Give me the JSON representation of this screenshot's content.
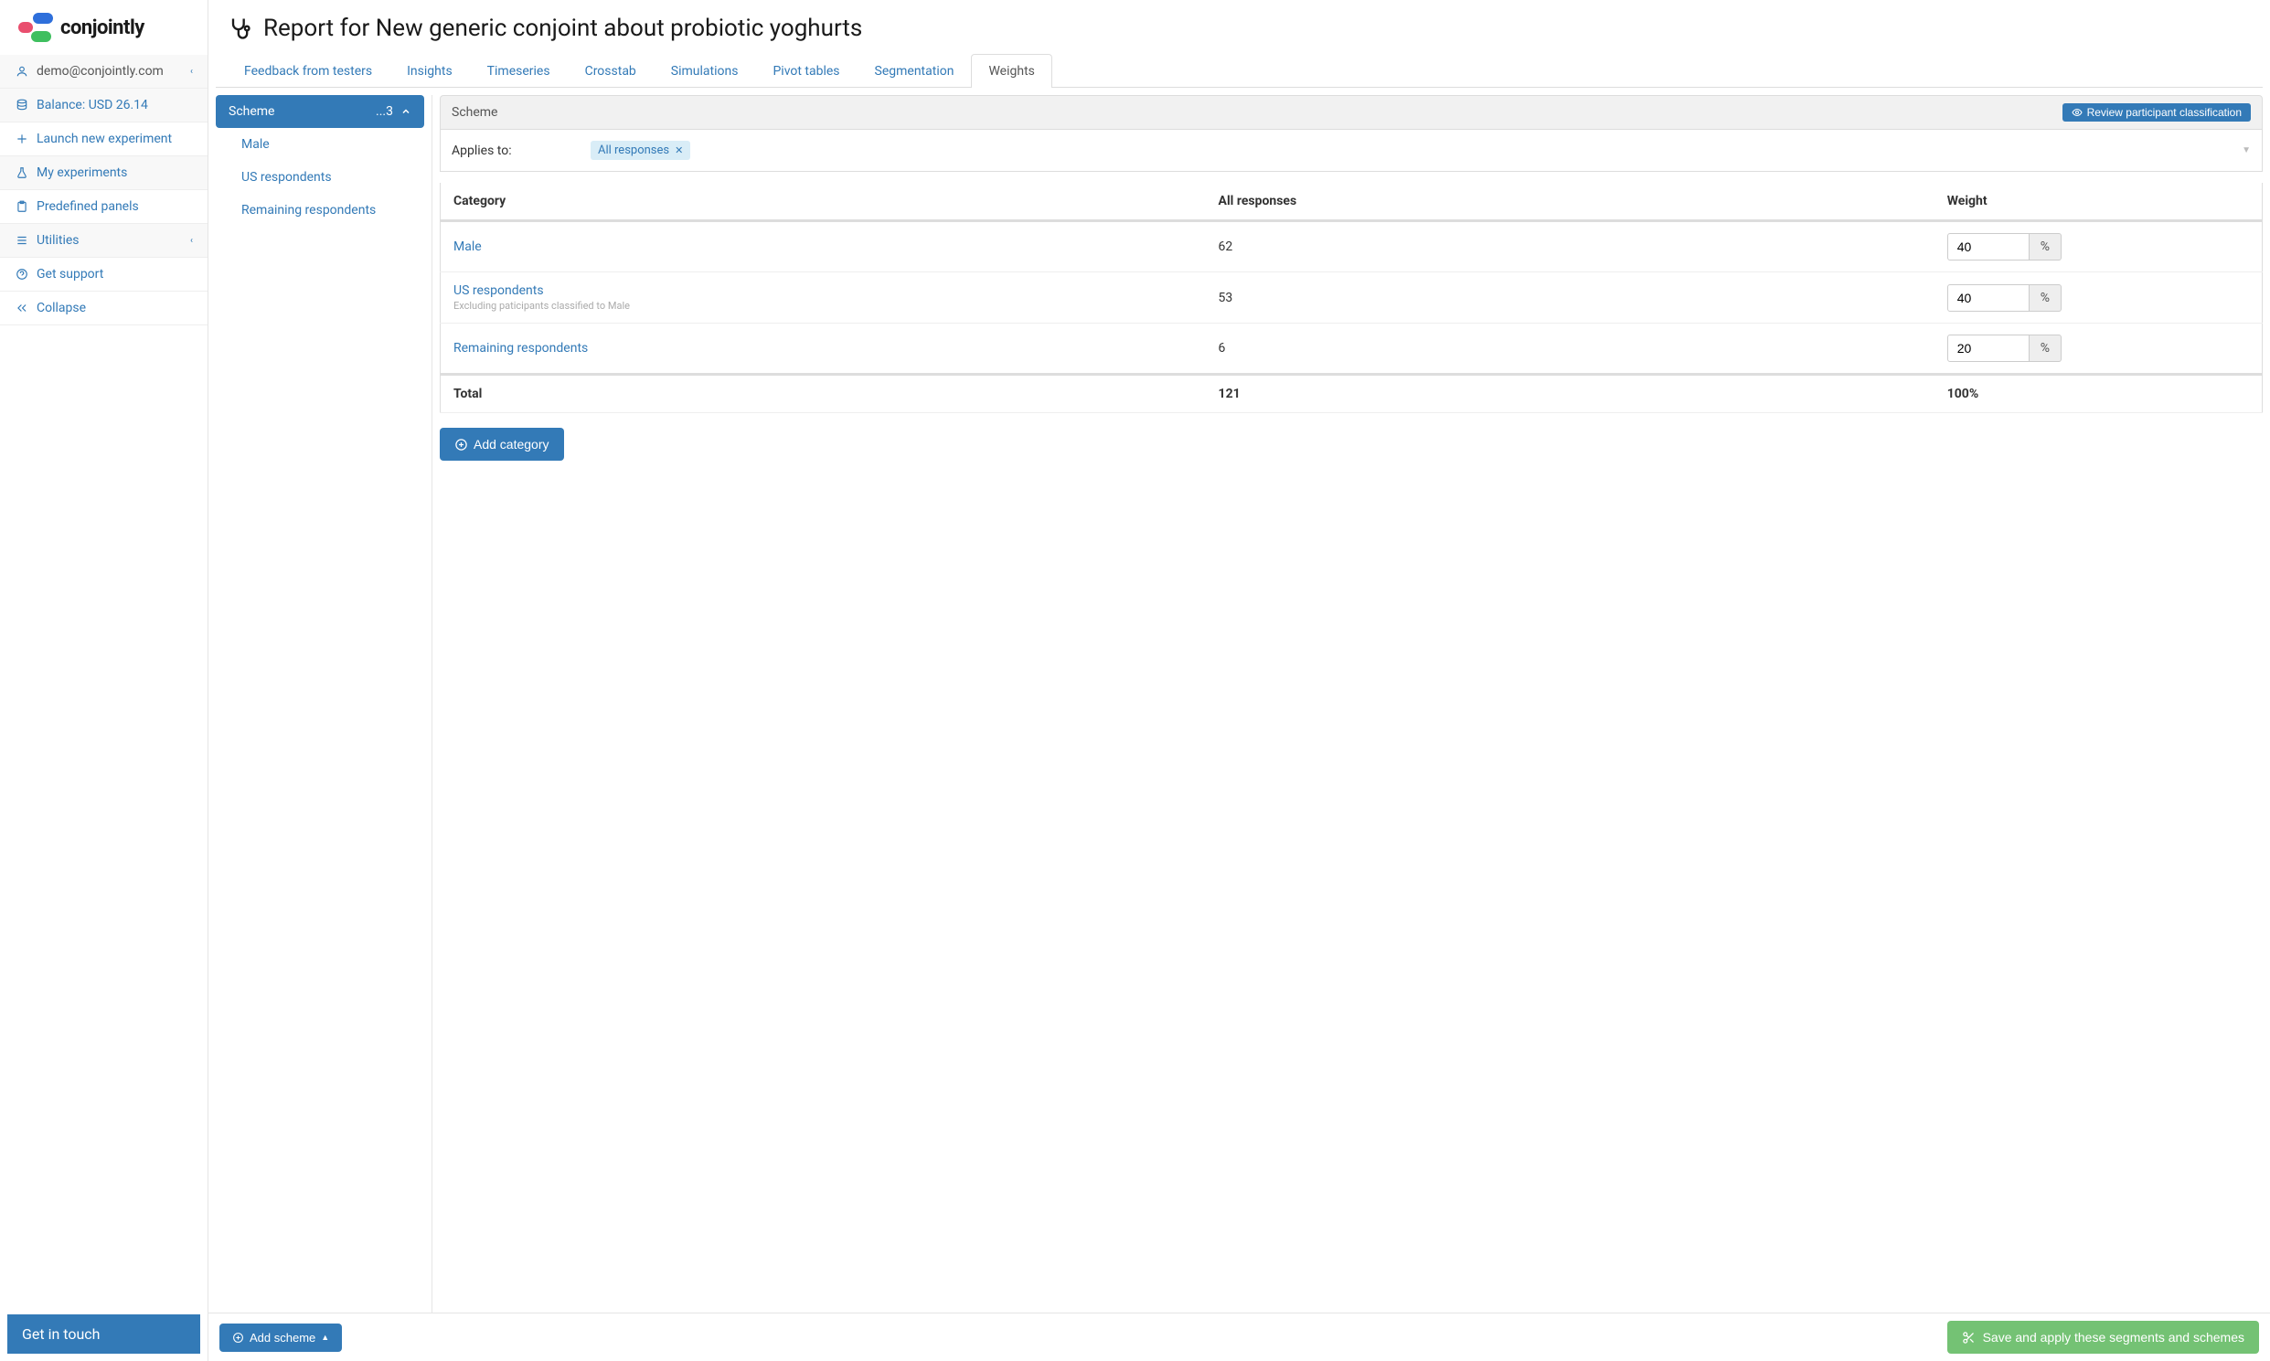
{
  "brand": {
    "name": "conjointly"
  },
  "sidebar": {
    "email": "demo@conjointly.com",
    "balance": "Balance: USD 26.14",
    "launch": "Launch new experiment",
    "my_experiments": "My experiments",
    "predefined_panels": "Predefined panels",
    "utilities": "Utilities",
    "support": "Get support",
    "collapse": "Collapse",
    "get_in_touch": "Get in touch"
  },
  "page": {
    "title": "Report for New generic conjoint about probiotic yoghurts"
  },
  "tabs": {
    "feedback": "Feedback from testers",
    "insights": "Insights",
    "timeseries": "Timeseries",
    "crosstab": "Crosstab",
    "simulations": "Simulations",
    "pivot": "Pivot tables",
    "segmentation": "Segmentation",
    "weights": "Weights"
  },
  "scheme_panel": {
    "label": "Scheme",
    "count": "...3",
    "items": [
      "Male",
      "US respondents",
      "Remaining respondents"
    ]
  },
  "detail": {
    "header_label": "Scheme",
    "review_btn": "Review participant classification",
    "applies_label": "Applies to:",
    "chip": "All responses",
    "table": {
      "headers": {
        "category": "Category",
        "responses": "All responses",
        "weight": "Weight"
      },
      "rows": [
        {
          "category": "Male",
          "sub": "",
          "responses": "62",
          "weight": "40"
        },
        {
          "category": "US respondents",
          "sub": "Excluding paticipants classified to Male",
          "responses": "53",
          "weight": "40"
        },
        {
          "category": "Remaining respondents",
          "sub": "",
          "responses": "6",
          "weight": "20"
        }
      ],
      "total_label": "Total",
      "total_responses": "121",
      "total_weight": "100%",
      "pct": "%"
    },
    "add_category": "Add category"
  },
  "footer": {
    "add_scheme": "Add scheme",
    "save": "Save and apply these segments and schemes"
  }
}
